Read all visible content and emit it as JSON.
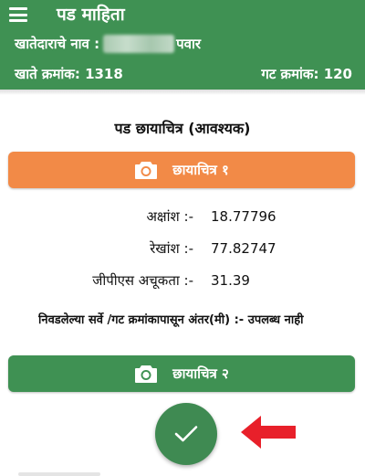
{
  "header": {
    "title": "पड माहिता",
    "owner_label": "खातेदाराचे नाव :",
    "owner_surname": "पवार",
    "account_label": "खाते क्रमांक:",
    "account_number": "1318",
    "gat_label": "गट क्रमांक:",
    "gat_number": "120",
    "background_color": "#3f9153"
  },
  "photo_section": {
    "title": "पड छायाचित्र (आवश्यक)",
    "photo1_label": "छायाचित्र १",
    "photo2_label": "छायाचित्र २",
    "photo1_color": "#f28a47",
    "photo2_color": "#3f9153",
    "icon": "camera-icon"
  },
  "location": {
    "latitude_label": "अक्षांश :-",
    "latitude_value": "18.77796",
    "longitude_label": "रेखांश :-",
    "longitude_value": "77.82747",
    "gps_label": "जीपीएस अचूकता :-",
    "gps_value": "31.39"
  },
  "distance_text": "निवडलेल्या सर्वे /गट क्रमांकापासून अंतर(मी) :- उपलब्ध नाही",
  "actions": {
    "confirm_icon": "check-icon",
    "pointer_icon": "red-arrow-icon",
    "pointer_color": "#e8202a"
  }
}
